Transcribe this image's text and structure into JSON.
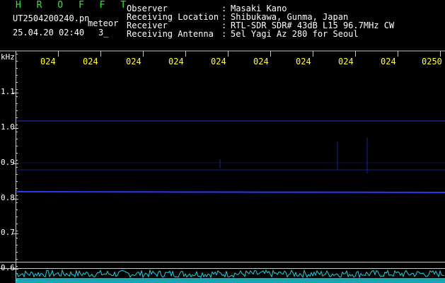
{
  "header": {
    "brand": "H R O F F T",
    "filename": "UT2504200240.pn",
    "type_label": "meteor",
    "datetime": "25.04.20 02:40",
    "index": "3_",
    "fields": [
      {
        "label": "Observer",
        "value": "Masaki Kano"
      },
      {
        "label": "Receiving Location",
        "value": "Shibukawa, Gunma, Japan"
      },
      {
        "label": "Receiver",
        "value": "RTL-SDR SDR# 43dB L15 96.7MHz CW"
      },
      {
        "label": "Receiving Antenna",
        "value": "5el Yagi Az 280 for Seoul"
      }
    ],
    "separator": ":"
  },
  "axis": {
    "unit": "kHz",
    "y_ticks": [
      "1.1",
      "1.0",
      "0.9",
      "0.8",
      "0.7",
      "0.6"
    ],
    "x_ticks": [
      "024",
      "024",
      "024",
      "024",
      "024",
      "024",
      "024",
      "024",
      "024",
      "0250"
    ]
  },
  "colors": {
    "background": "#000000",
    "signal": "#2a3cff",
    "grid": "#c8c8c8",
    "noise_floor": "#1fd0e0",
    "time_label": "#ffff33",
    "brand": "#35e835"
  }
}
